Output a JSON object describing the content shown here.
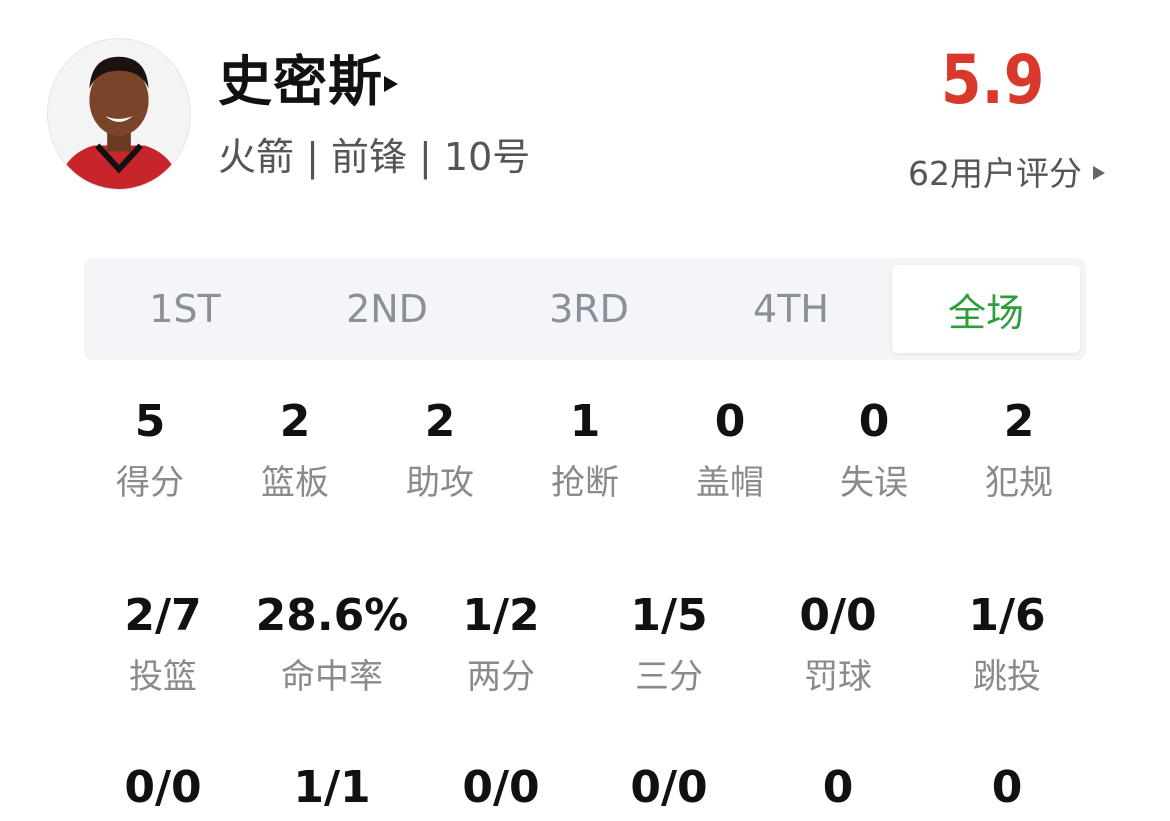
{
  "player": {
    "name": "史密斯",
    "meta": "火箭 | 前锋 | 10号",
    "avatar_icon": "player-portrait"
  },
  "rating": {
    "score": "5.9",
    "count_label": "62用户评分",
    "score_color": "#d8392b"
  },
  "tabs": [
    {
      "label": "1ST",
      "active": false
    },
    {
      "label": "2ND",
      "active": false
    },
    {
      "label": "3RD",
      "active": false
    },
    {
      "label": "4TH",
      "active": false
    },
    {
      "label": "全场",
      "active": true
    }
  ],
  "accent_color": "#2e9e3a",
  "basic_stats": [
    {
      "value": "5",
      "label": "得分"
    },
    {
      "value": "2",
      "label": "篮板"
    },
    {
      "value": "2",
      "label": "助攻"
    },
    {
      "value": "1",
      "label": "抢断"
    },
    {
      "value": "0",
      "label": "盖帽"
    },
    {
      "value": "0",
      "label": "失误"
    },
    {
      "value": "2",
      "label": "犯规"
    }
  ],
  "shooting_stats": [
    {
      "value": "2/7",
      "label": "投篮"
    },
    {
      "value": "28.6%",
      "label": "命中率"
    },
    {
      "value": "1/2",
      "label": "两分"
    },
    {
      "value": "1/5",
      "label": "三分"
    },
    {
      "value": "0/0",
      "label": "罚球"
    },
    {
      "value": "1/6",
      "label": "跳投"
    }
  ],
  "more_stats": [
    {
      "value": "0/0"
    },
    {
      "value": "1/1"
    },
    {
      "value": "0/0"
    },
    {
      "value": "0/0"
    },
    {
      "value": "0"
    },
    {
      "value": "0"
    }
  ]
}
